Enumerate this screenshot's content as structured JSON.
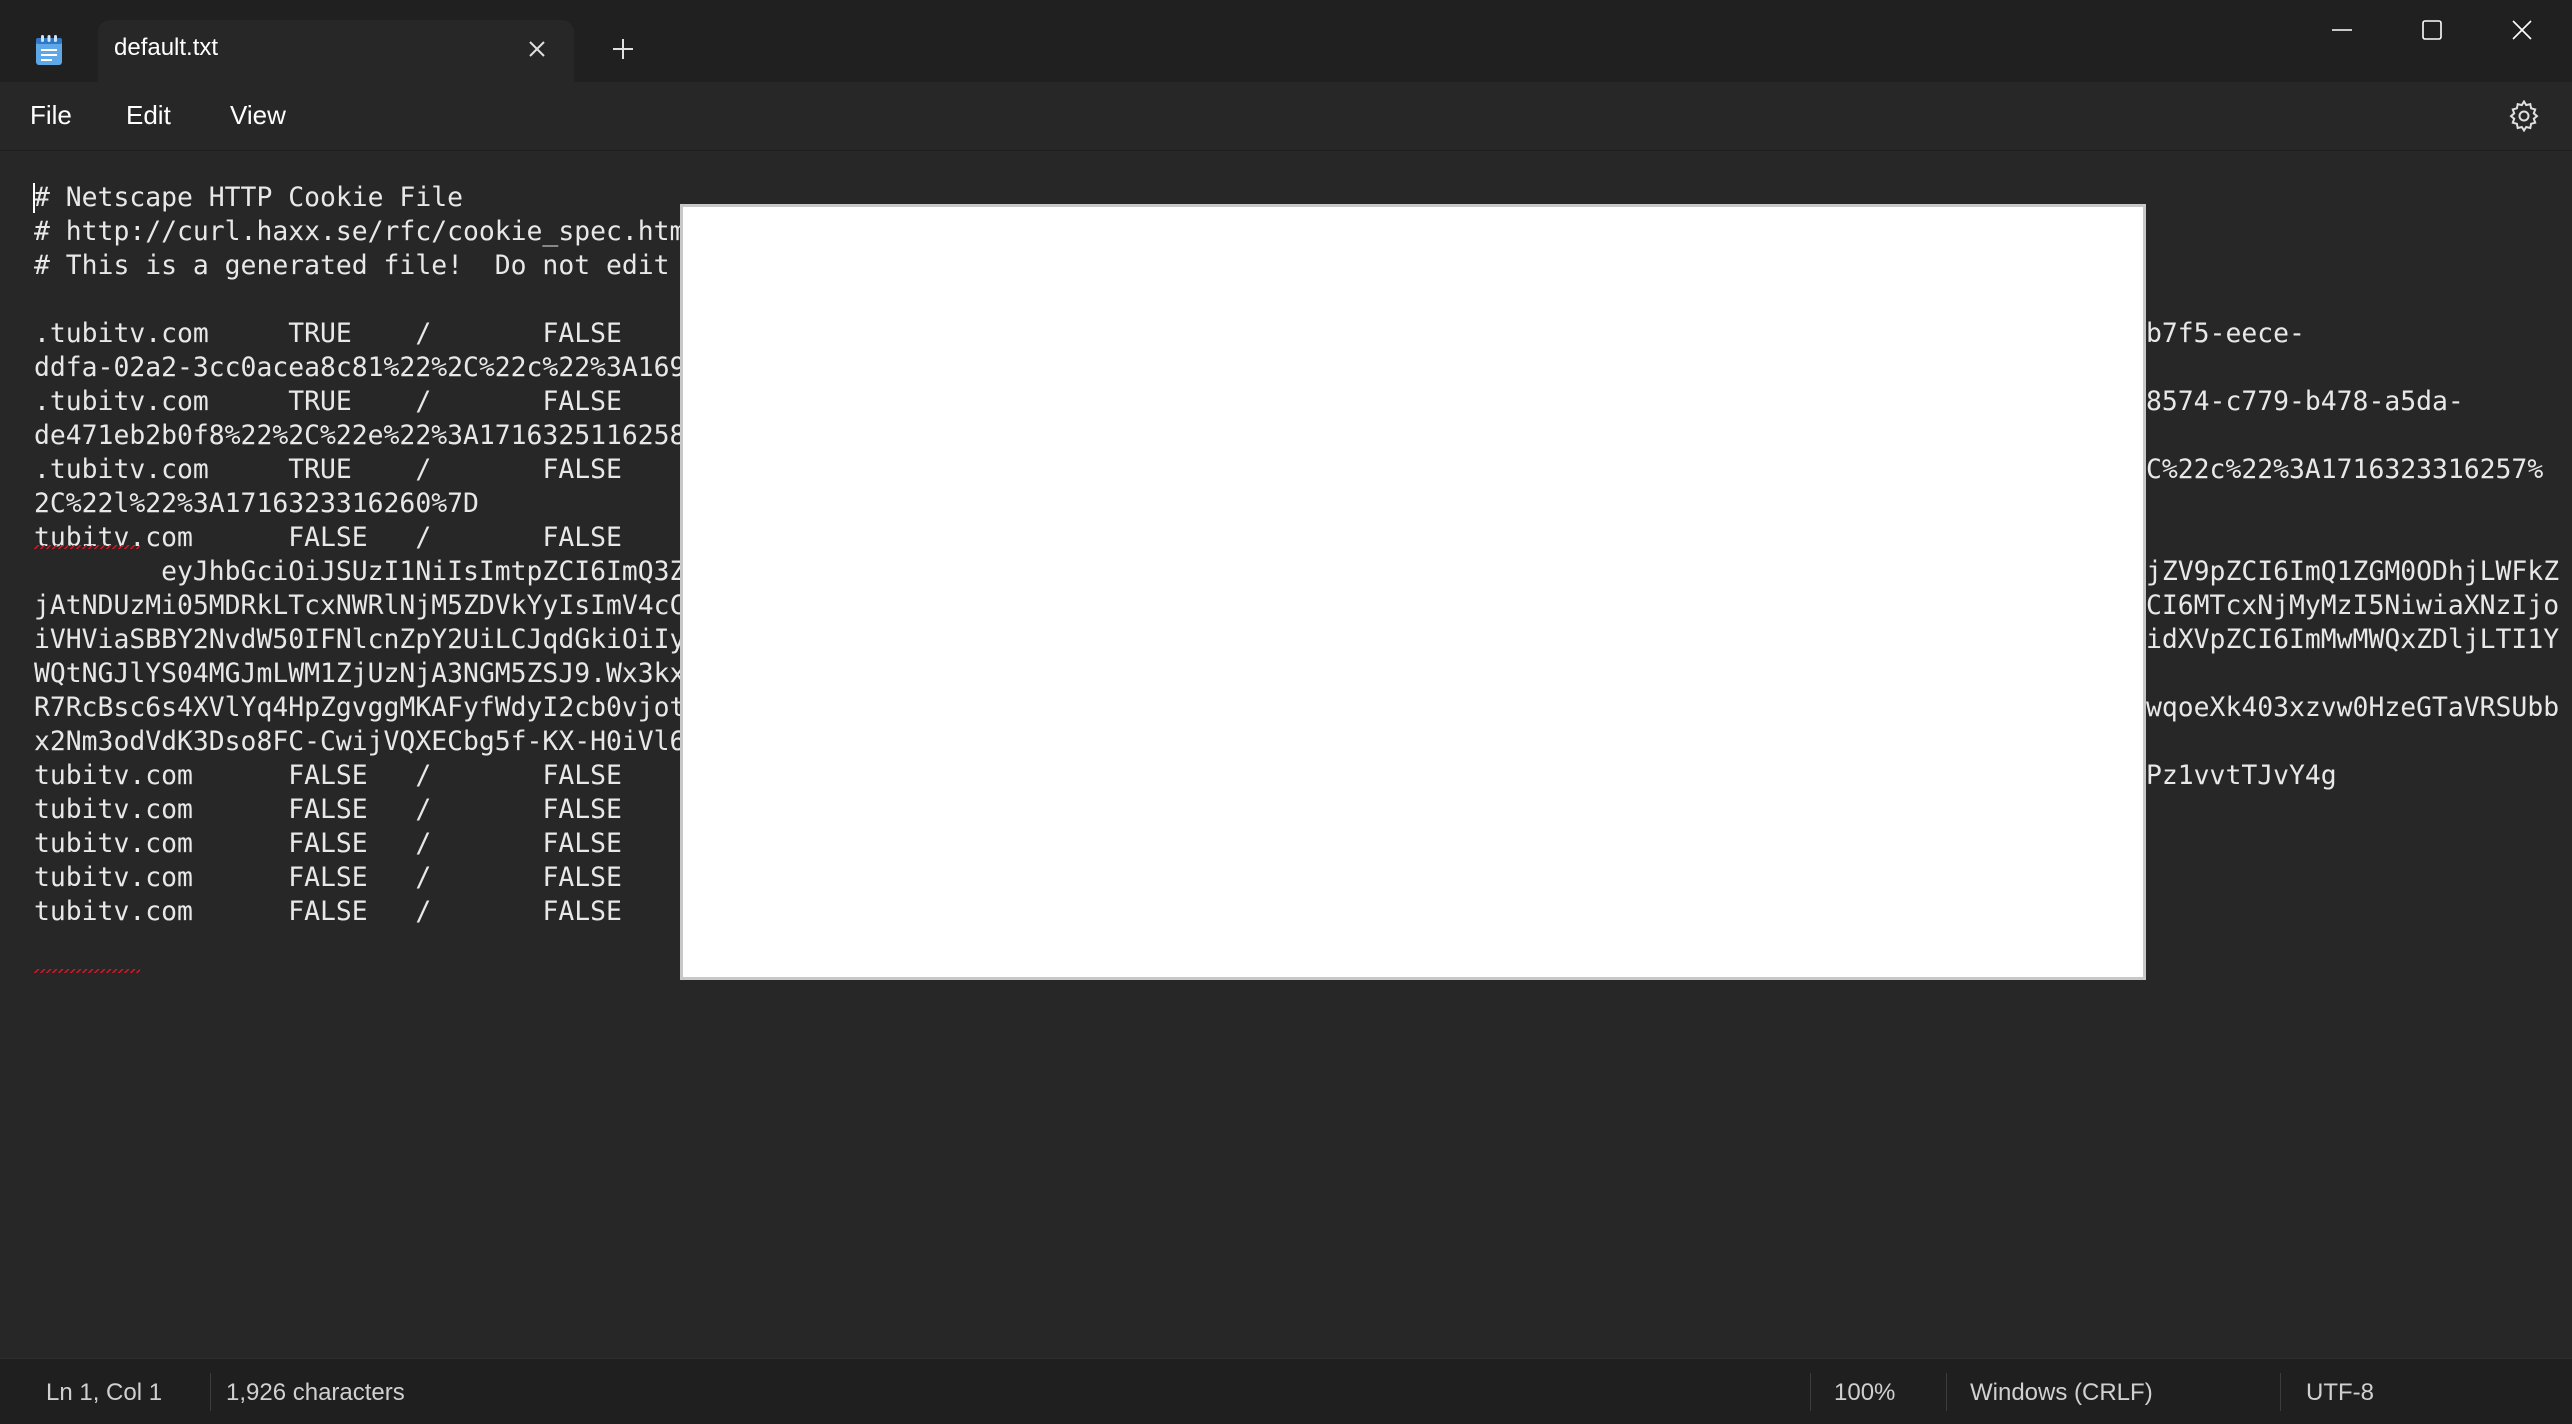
{
  "window": {
    "tab_title": "default.txt",
    "icons": {
      "app": "notepad-icon",
      "close_tab": "close-icon",
      "new_tab": "plus-icon",
      "minimize": "minimize-icon",
      "maximize": "maximize-icon",
      "close_window": "close-icon"
    }
  },
  "menu": {
    "file": "File",
    "edit": "Edit",
    "view": "View",
    "settings_icon": "gear-icon"
  },
  "editor": {
    "lines": [
      "# Netscape HTTP Cookie File",
      "# http://curl.haxx.se/rfc/cookie_spec.htm",
      "# This is a generated file!  Do not edit",
      "",
      ".tubitv.com\tTRUE\t/\tFALSE\t\t\t\t\t\t\t\t\t\t\t\t\t\t\t\t\t\t\t\t\t\t\t\t\t\t\t\t\t\t\t\t\t\t\t\t\t\t\t\t\t\t\t\t\t\t\t\t\t\t\t\t\t\t\t\t\t\t\t\t\t\t\t\t\t\t\t\t\t\t\t\t\t\t\t\t\t\t\t\t\t\t\t\t\t\t\t\t\t\t\t\t\t\t\t\t",
      "ddfa-02a2-3cc0acea8c81%22%2C%22c%22%3A169",
      ".tubitv.com\tTRUE\t/\tFALSE",
      "de471eb2b0f8%22%2C%22e%22%3A1716325116258",
      ".tubitv.com\tTRUE\t/\tFALSE",
      "2C%22l%22%3A1716323316260%7D",
      "tubitv.com\tFALSE\t/\tFALSE",
      "\teyJhbGciOiJSUzI1NiIsImtpZCI6ImQ3Z",
      "jAtNDUzMi05MDRkLTcxNWRlNjM5ZDVkYyIsImV4cC",
      "iVHViaSBBY2NvdW50IFNlcnZpY2UiLCJqdGkiOiIy",
      "WQtNGJlYS04MGJmLWM1ZjUzNjA3NGM5ZSJ9.Wx3kx",
      "R7RcBsc6s4XVlYq4HpZgvggMKAFyfWdyI2cb0vjot",
      "x2Nm3odVdK3Dso8FC-CwijVQXECbg5f-KX-H0iVl6",
      "tubitv.com\tFALSE\t/\tFALSE",
      "tubitv.com\tFALSE\t/\tFALSE",
      "tubitv.com\tFALSE\t/\tFALSE",
      "tubitv.com\tFALSE\t/\tFALSE",
      "tubitv.com\tFALSE\t/\tFALSE"
    ],
    "right_fragments": [
      "b7f5-eece-",
      "8574-c779-b478-a5da-",
      "C%22c%22%3A1716323316257%",
      "jZV9pZCI6ImQ1ZGM0ODhjLWFkZ",
      "CI6MTcxNjMyMzI5NiwiaXNzIjo",
      "idXVpZCI6ImMwMWQxZDljLTI1Y",
      "wqoeXk403xzvw0HzeGTaVRSUbb",
      "Pz1vvtTJvY4g"
    ]
  },
  "status": {
    "position": "Ln 1, Col 1",
    "characters": "1,926 characters",
    "zoom": "100%",
    "line_ending": "Windows (CRLF)",
    "encoding": "UTF-8"
  }
}
